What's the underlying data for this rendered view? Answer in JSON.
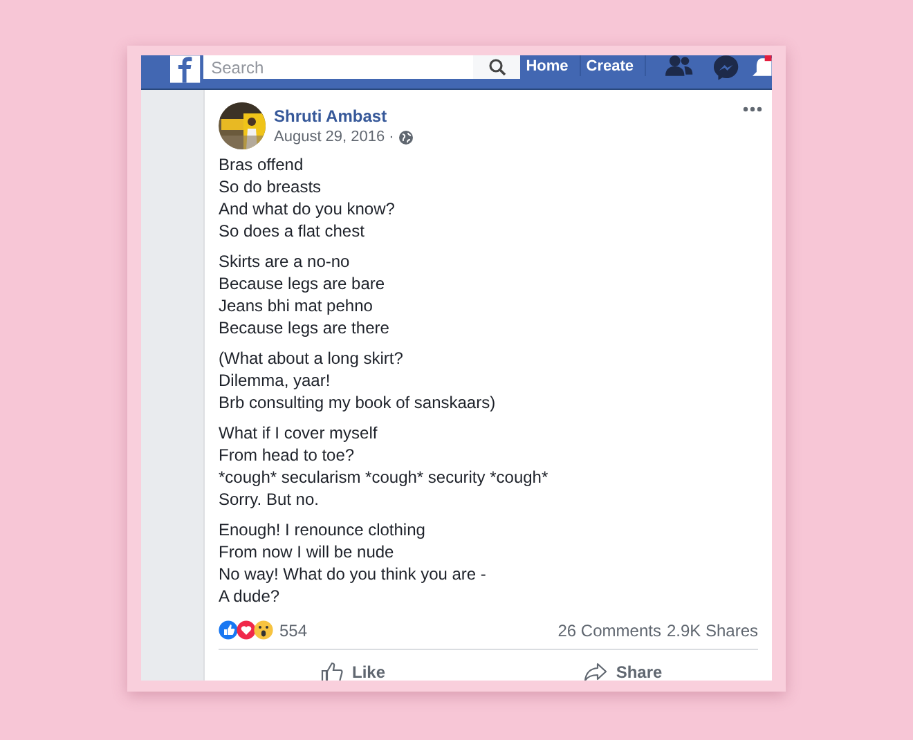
{
  "navbar": {
    "search": {
      "placeholder": "Search"
    },
    "links": [
      "Home",
      "Create"
    ]
  },
  "post": {
    "author": "Shruti Ambast",
    "date": "August 29, 2016 ·",
    "stanzas": [
      [
        "Bras offend",
        "So do breasts",
        "And what do you know?",
        "So does a flat chest"
      ],
      [
        "Skirts are a no-no",
        "Because legs are bare",
        "Jeans bhi mat pehno",
        "Because legs are there"
      ],
      [
        "(What about a long skirt?",
        "Dilemma, yaar!",
        "Brb consulting my book of sanskaars)"
      ],
      [
        "What if I cover myself",
        "From head to toe?",
        "*cough* secularism *cough* security *cough*",
        "Sorry. But no."
      ],
      [
        "Enough! I renounce clothing",
        "From now I will be nude",
        "No way! What do you think you are -",
        "A dude?"
      ]
    ],
    "reaction_count": "554",
    "comments": "26 Comments",
    "shares": "2.9K Shares",
    "actions": [
      {
        "kind": "like",
        "label": "Like"
      },
      {
        "kind": "share",
        "label": "Share"
      }
    ]
  }
}
